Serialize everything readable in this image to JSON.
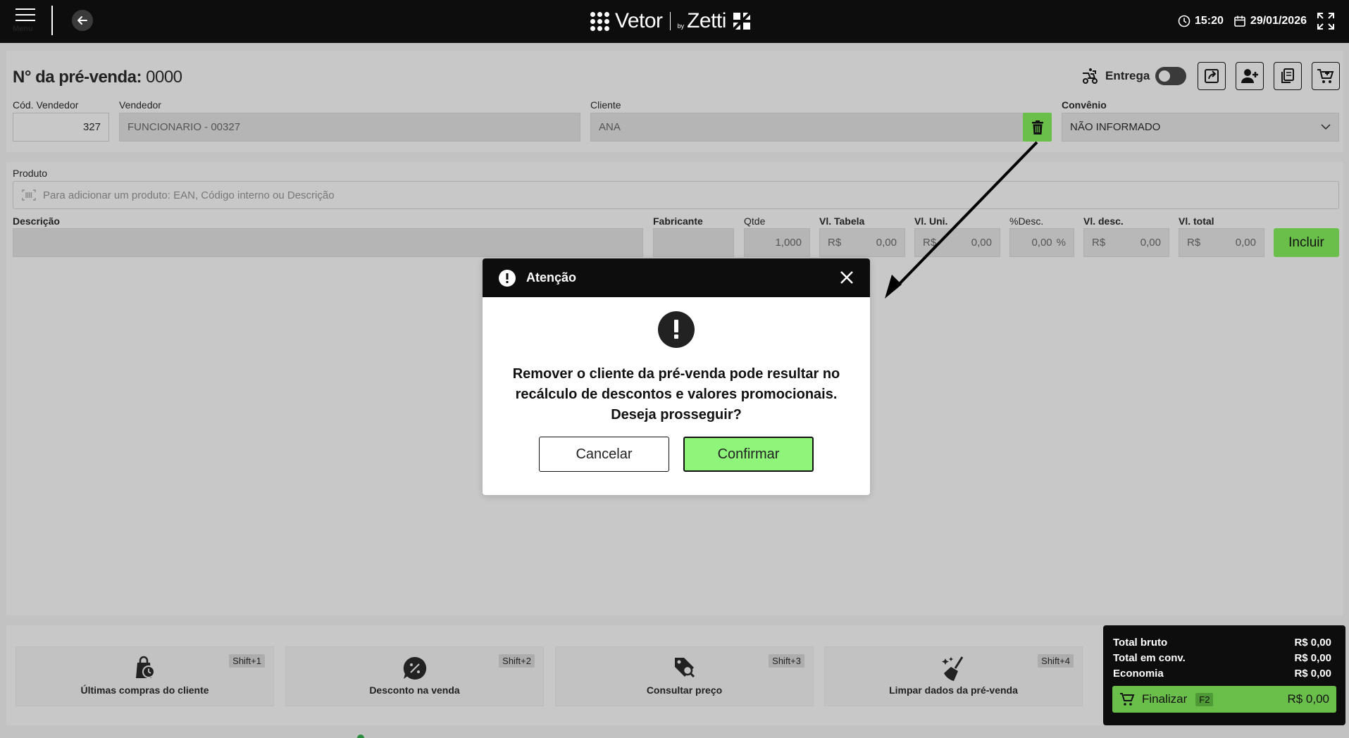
{
  "topbar": {
    "menu_label": "Menu",
    "brand_left": "Vetor",
    "brand_by": "by",
    "brand_right": "Zetti",
    "time": "15:20",
    "date": "29/01/2026"
  },
  "header": {
    "title_label": "N° da pré-venda:",
    "title_number": "0000",
    "entrega_label": "Entrega",
    "entrega_on": false,
    "cod_vendedor_label": "Cód. Vendedor",
    "cod_vendedor_value": "327",
    "vendedor_label": "Vendedor",
    "vendedor_value": "FUNCIONARIO - 00327",
    "cliente_label": "Cliente",
    "cliente_value": "ANA",
    "convenio_label": "Convênio",
    "convenio_value": "NÃO INFORMADO"
  },
  "product": {
    "produto_label": "Produto",
    "produto_placeholder": "Para adicionar um produto: EAN, Código interno ou Descrição",
    "descricao_label": "Descrição",
    "fabricante_label": "Fabricante",
    "qtde_label": "Qtde",
    "qtde_value": "1,000",
    "vl_tabela_label": "Vl. Tabela",
    "vl_uni_label": "Vl. Uni.",
    "desc_pct_label": "%Desc.",
    "vl_desc_label": "Vl. desc.",
    "vl_total_label": "Vl. total",
    "currency": "R$",
    "zero": "0,00",
    "pct": "%",
    "incluir_label": "Incluir"
  },
  "shortcuts": [
    {
      "label": "Últimas compras do cliente",
      "key": "Shift+1"
    },
    {
      "label": "Desconto na venda",
      "key": "Shift+2"
    },
    {
      "label": "Consultar preço",
      "key": "Shift+3"
    },
    {
      "label": "Limpar dados da pré-venda",
      "key": "Shift+4"
    }
  ],
  "totals": {
    "bruto_label": "Total bruto",
    "bruto_value": "R$ 0,00",
    "conv_label": "Total em conv.",
    "conv_value": "R$ 0,00",
    "economia_label": "Economia",
    "economia_value": "R$ 0,00",
    "finalizar_label": "Finalizar",
    "finalizar_key": "F2",
    "finalizar_value": "R$  0,00"
  },
  "modal": {
    "title": "Atenção",
    "message_line1": "Remover o cliente da pré-venda pode resultar no",
    "message_line2": "recálculo de descontos e valores promocionais.",
    "message_line3": "Deseja prosseguir?",
    "cancel_label": "Cancelar",
    "confirm_label": "Confirmar"
  },
  "colors": {
    "accent_green": "#6abf4b",
    "confirm_green": "#8ef57a",
    "dark": "#0d0d0d"
  }
}
